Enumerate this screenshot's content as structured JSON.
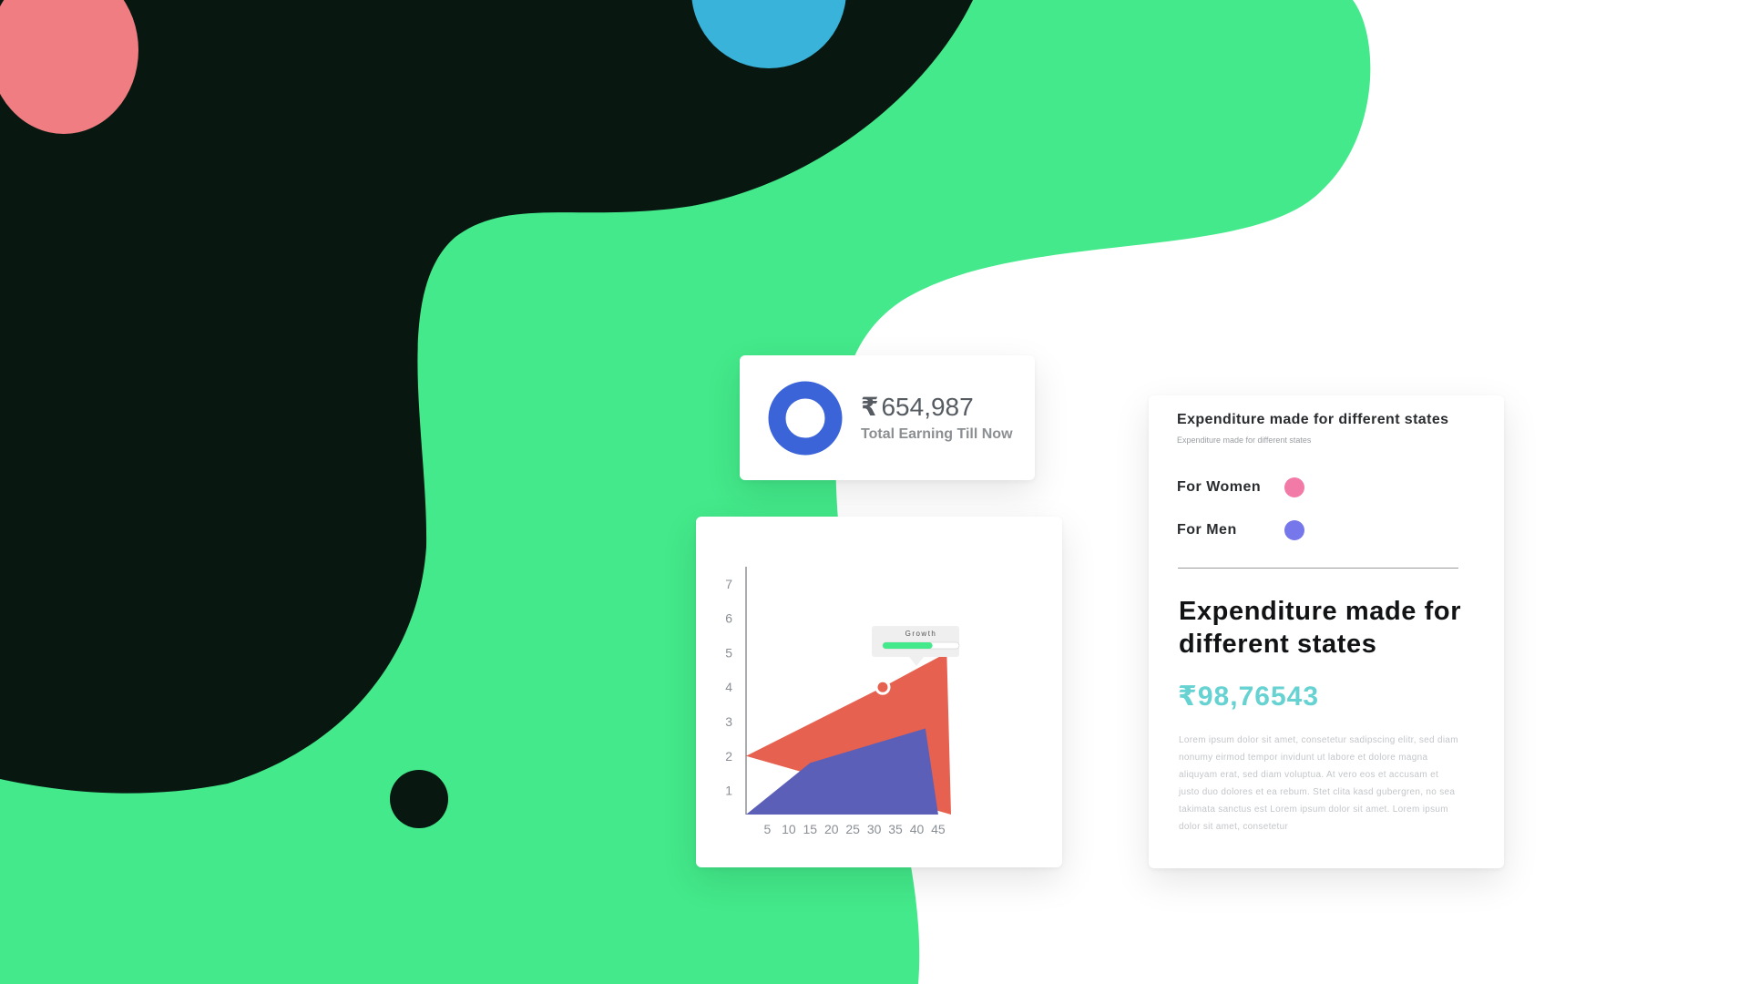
{
  "colors": {
    "green": "#43e98a",
    "dark": "#081710",
    "coral": "#ef7d82",
    "sky": "#39b3d9",
    "donut": "#3b64d9",
    "area_red": "#e6614f",
    "area_blue": "#5b5fb7",
    "women": "#f27aa6",
    "men": "#7677ea",
    "amount": "#67d2d2"
  },
  "earnings": {
    "currency": "₹",
    "amount": "654,987",
    "label": "Total Earning Till Now"
  },
  "tooltip": {
    "label": "Growth",
    "progress": 0.65
  },
  "chart_data": {
    "type": "area",
    "x_ticks": [
      "5",
      "10",
      "15",
      "20",
      "25",
      "30",
      "35",
      "40",
      "45"
    ],
    "y_ticks": [
      "1",
      "2",
      "3",
      "4",
      "5",
      "6",
      "7"
    ],
    "xlim": [
      0,
      48
    ],
    "ylim": [
      0.3,
      7.5
    ],
    "series": [
      {
        "color": "#e6614f",
        "points": [
          [
            0,
            2.0
          ],
          [
            32,
            4.0
          ],
          [
            47,
            5.0
          ],
          [
            48,
            0.3
          ]
        ]
      },
      {
        "color": "#5b5fb7",
        "points": [
          [
            0,
            0.3
          ],
          [
            15,
            1.8
          ],
          [
            42,
            2.8
          ],
          [
            45,
            0.3
          ]
        ]
      }
    ],
    "highlight": {
      "x": 32,
      "y": 4.0
    }
  },
  "info": {
    "title": "Expenditure made for different states",
    "subtitle": "Expenditure made for different states",
    "legend": [
      {
        "label": "For Women",
        "color": "#f27aa6"
      },
      {
        "label": "For Men",
        "color": "#7677ea"
      }
    ],
    "heading": "Expenditure made for different states",
    "currency": "₹",
    "amount": "98,76543",
    "body": "Lorem ipsum dolor sit amet, consetetur sadipscing elitr, sed diam nonumy eirmod tempor invidunt ut labore et dolore magna aliquyam erat, sed diam voluptua. At vero eos et accusam et justo duo dolores et ea rebum. Stet clita kasd gubergren, no sea takimata sanctus est Lorem ipsum dolor sit amet. Lorem ipsum dolor sit amet, consetetur"
  }
}
